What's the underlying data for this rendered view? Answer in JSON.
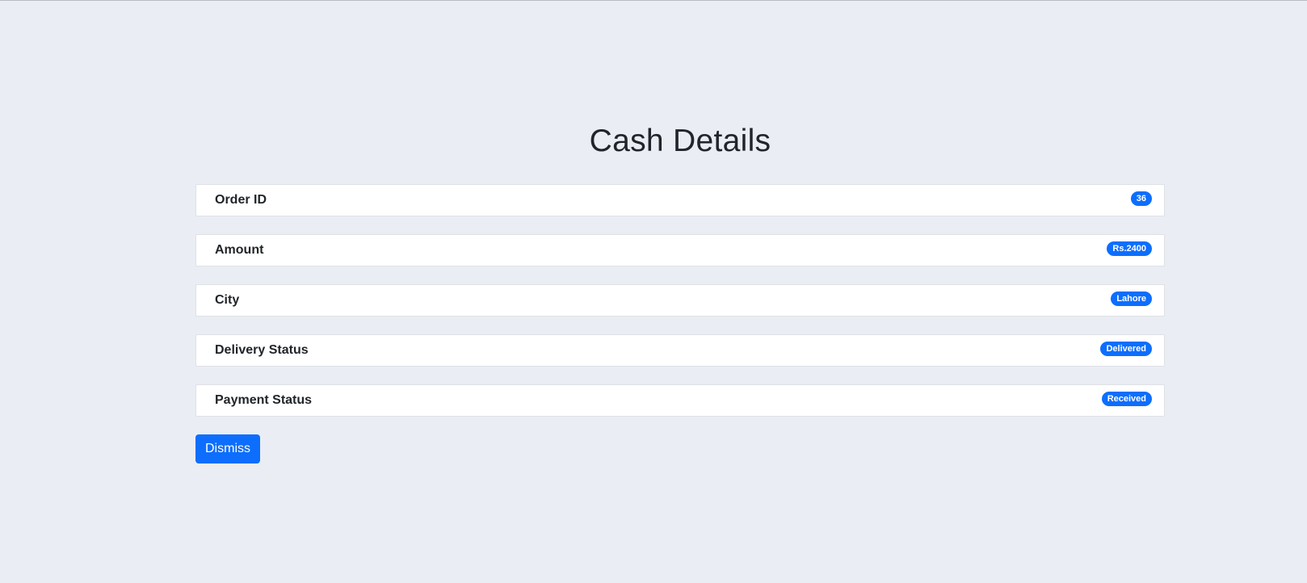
{
  "page": {
    "title": "Cash Details"
  },
  "details": [
    {
      "label": "Order ID",
      "value": "36"
    },
    {
      "label": "Amount",
      "value": "Rs.2400"
    },
    {
      "label": "City",
      "value": "Lahore"
    },
    {
      "label": "Delivery Status",
      "value": "Delivered"
    },
    {
      "label": "Payment Status",
      "value": "Received"
    }
  ],
  "actions": {
    "dismiss_label": "Dismiss"
  },
  "colors": {
    "background": "#eaedf4",
    "accent": "#0d6efd",
    "card": "#ffffff",
    "text": "#212529"
  }
}
